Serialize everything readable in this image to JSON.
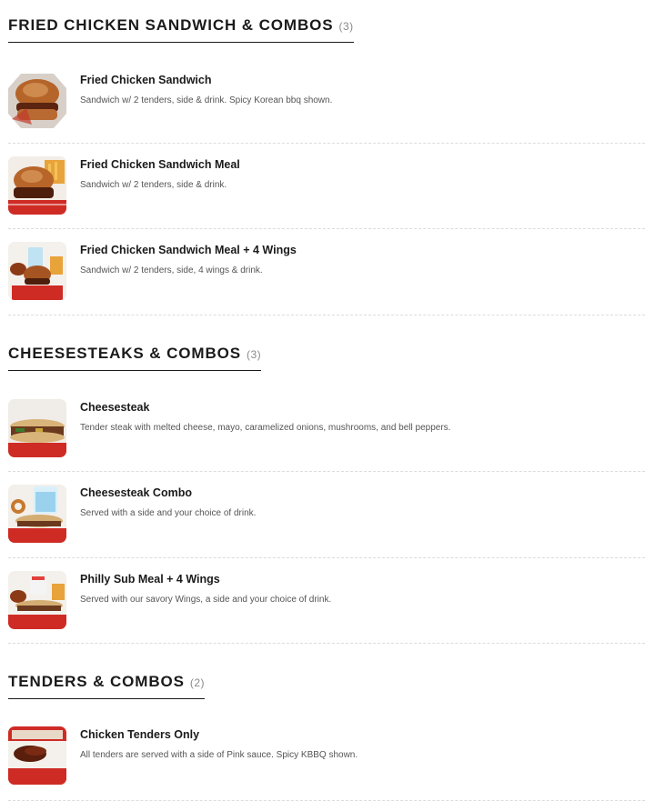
{
  "sections": [
    {
      "title": "FRIED CHICKEN SANDWICH & COMBOS",
      "count": "(3)",
      "items": [
        {
          "name": "Fried Chicken Sandwich",
          "description": "Sandwich w/ 2 tenders, side & drink. Spicy Korean bbq shown.",
          "image": "fried-chicken-sandwich-photo"
        },
        {
          "name": "Fried Chicken Sandwich Meal",
          "description": "Sandwich w/ 2 tenders, side & drink.",
          "image": "fried-chicken-sandwich-meal-photo"
        },
        {
          "name": "Fried Chicken Sandwich Meal + 4 Wings",
          "description": "Sandwich w/ 2 tenders, side, 4 wings & drink.",
          "image": "sandwich-meal-wings-photo"
        }
      ]
    },
    {
      "title": "CHEESESTEAKS & COMBOS",
      "count": "(3)",
      "items": [
        {
          "name": "Cheesesteak",
          "description": "Tender steak with melted cheese, mayo, caramelized onions, mushrooms, and bell peppers.",
          "image": "cheesesteak-photo"
        },
        {
          "name": "Cheesesteak Combo",
          "description": "Served with a side and your choice of drink.",
          "image": "cheesesteak-combo-photo"
        },
        {
          "name": "Philly Sub Meal + 4 Wings",
          "description": "Served with our savory Wings, a side and your choice of drink.",
          "image": "philly-sub-meal-photo"
        }
      ]
    },
    {
      "title": "TENDERS & COMBOS",
      "count": "(2)",
      "items": [
        {
          "name": "Chicken Tenders Only",
          "description": "All tenders are served with a side of Pink sauce. Spicy KBBQ shown.",
          "image": "chicken-tenders-photo"
        }
      ]
    }
  ]
}
